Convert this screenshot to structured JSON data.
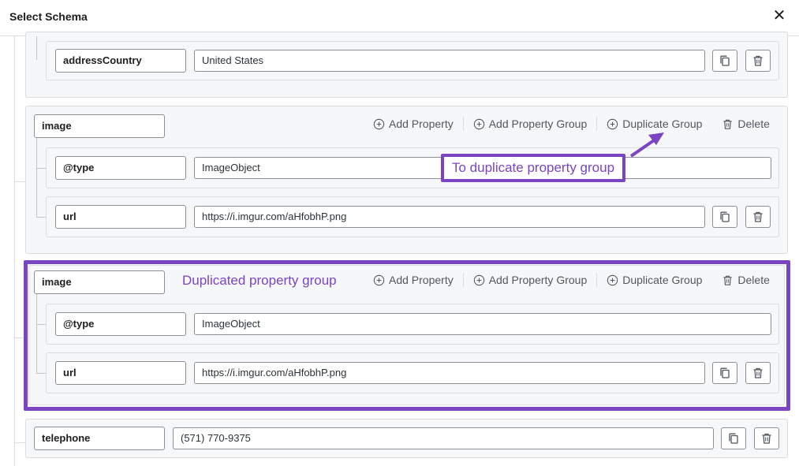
{
  "modal": {
    "title": "Select Schema",
    "close_glyph": "✕"
  },
  "actions": {
    "add_property": "Add Property",
    "add_property_group": "Add Property Group",
    "duplicate_group": "Duplicate Group",
    "delete": "Delete"
  },
  "rows": {
    "address_country": {
      "key": "addressCountry",
      "value": "United States"
    },
    "telephone": {
      "key": "telephone",
      "value": "(571) 770-9375"
    }
  },
  "groups": [
    {
      "name": "image",
      "properties": [
        {
          "key": "@type",
          "value": "ImageObject"
        },
        {
          "key": "url",
          "value": "https://i.imgur.com/aHfobhP.png"
        }
      ]
    },
    {
      "name": "image",
      "properties": [
        {
          "key": "@type",
          "value": "ImageObject"
        },
        {
          "key": "url",
          "value": "https://i.imgur.com/aHfobhP.png"
        }
      ]
    }
  ],
  "annotations": {
    "duplicate_callout": "To duplicate property group",
    "duplicated_label": "Duplicated property group"
  },
  "colors": {
    "highlight": "#7b44c2",
    "border": "#dcdcde",
    "panel": "#f6f7f9"
  },
  "icons": [
    "close-icon",
    "plus-circle-icon",
    "trash-icon",
    "copy-icon"
  ]
}
